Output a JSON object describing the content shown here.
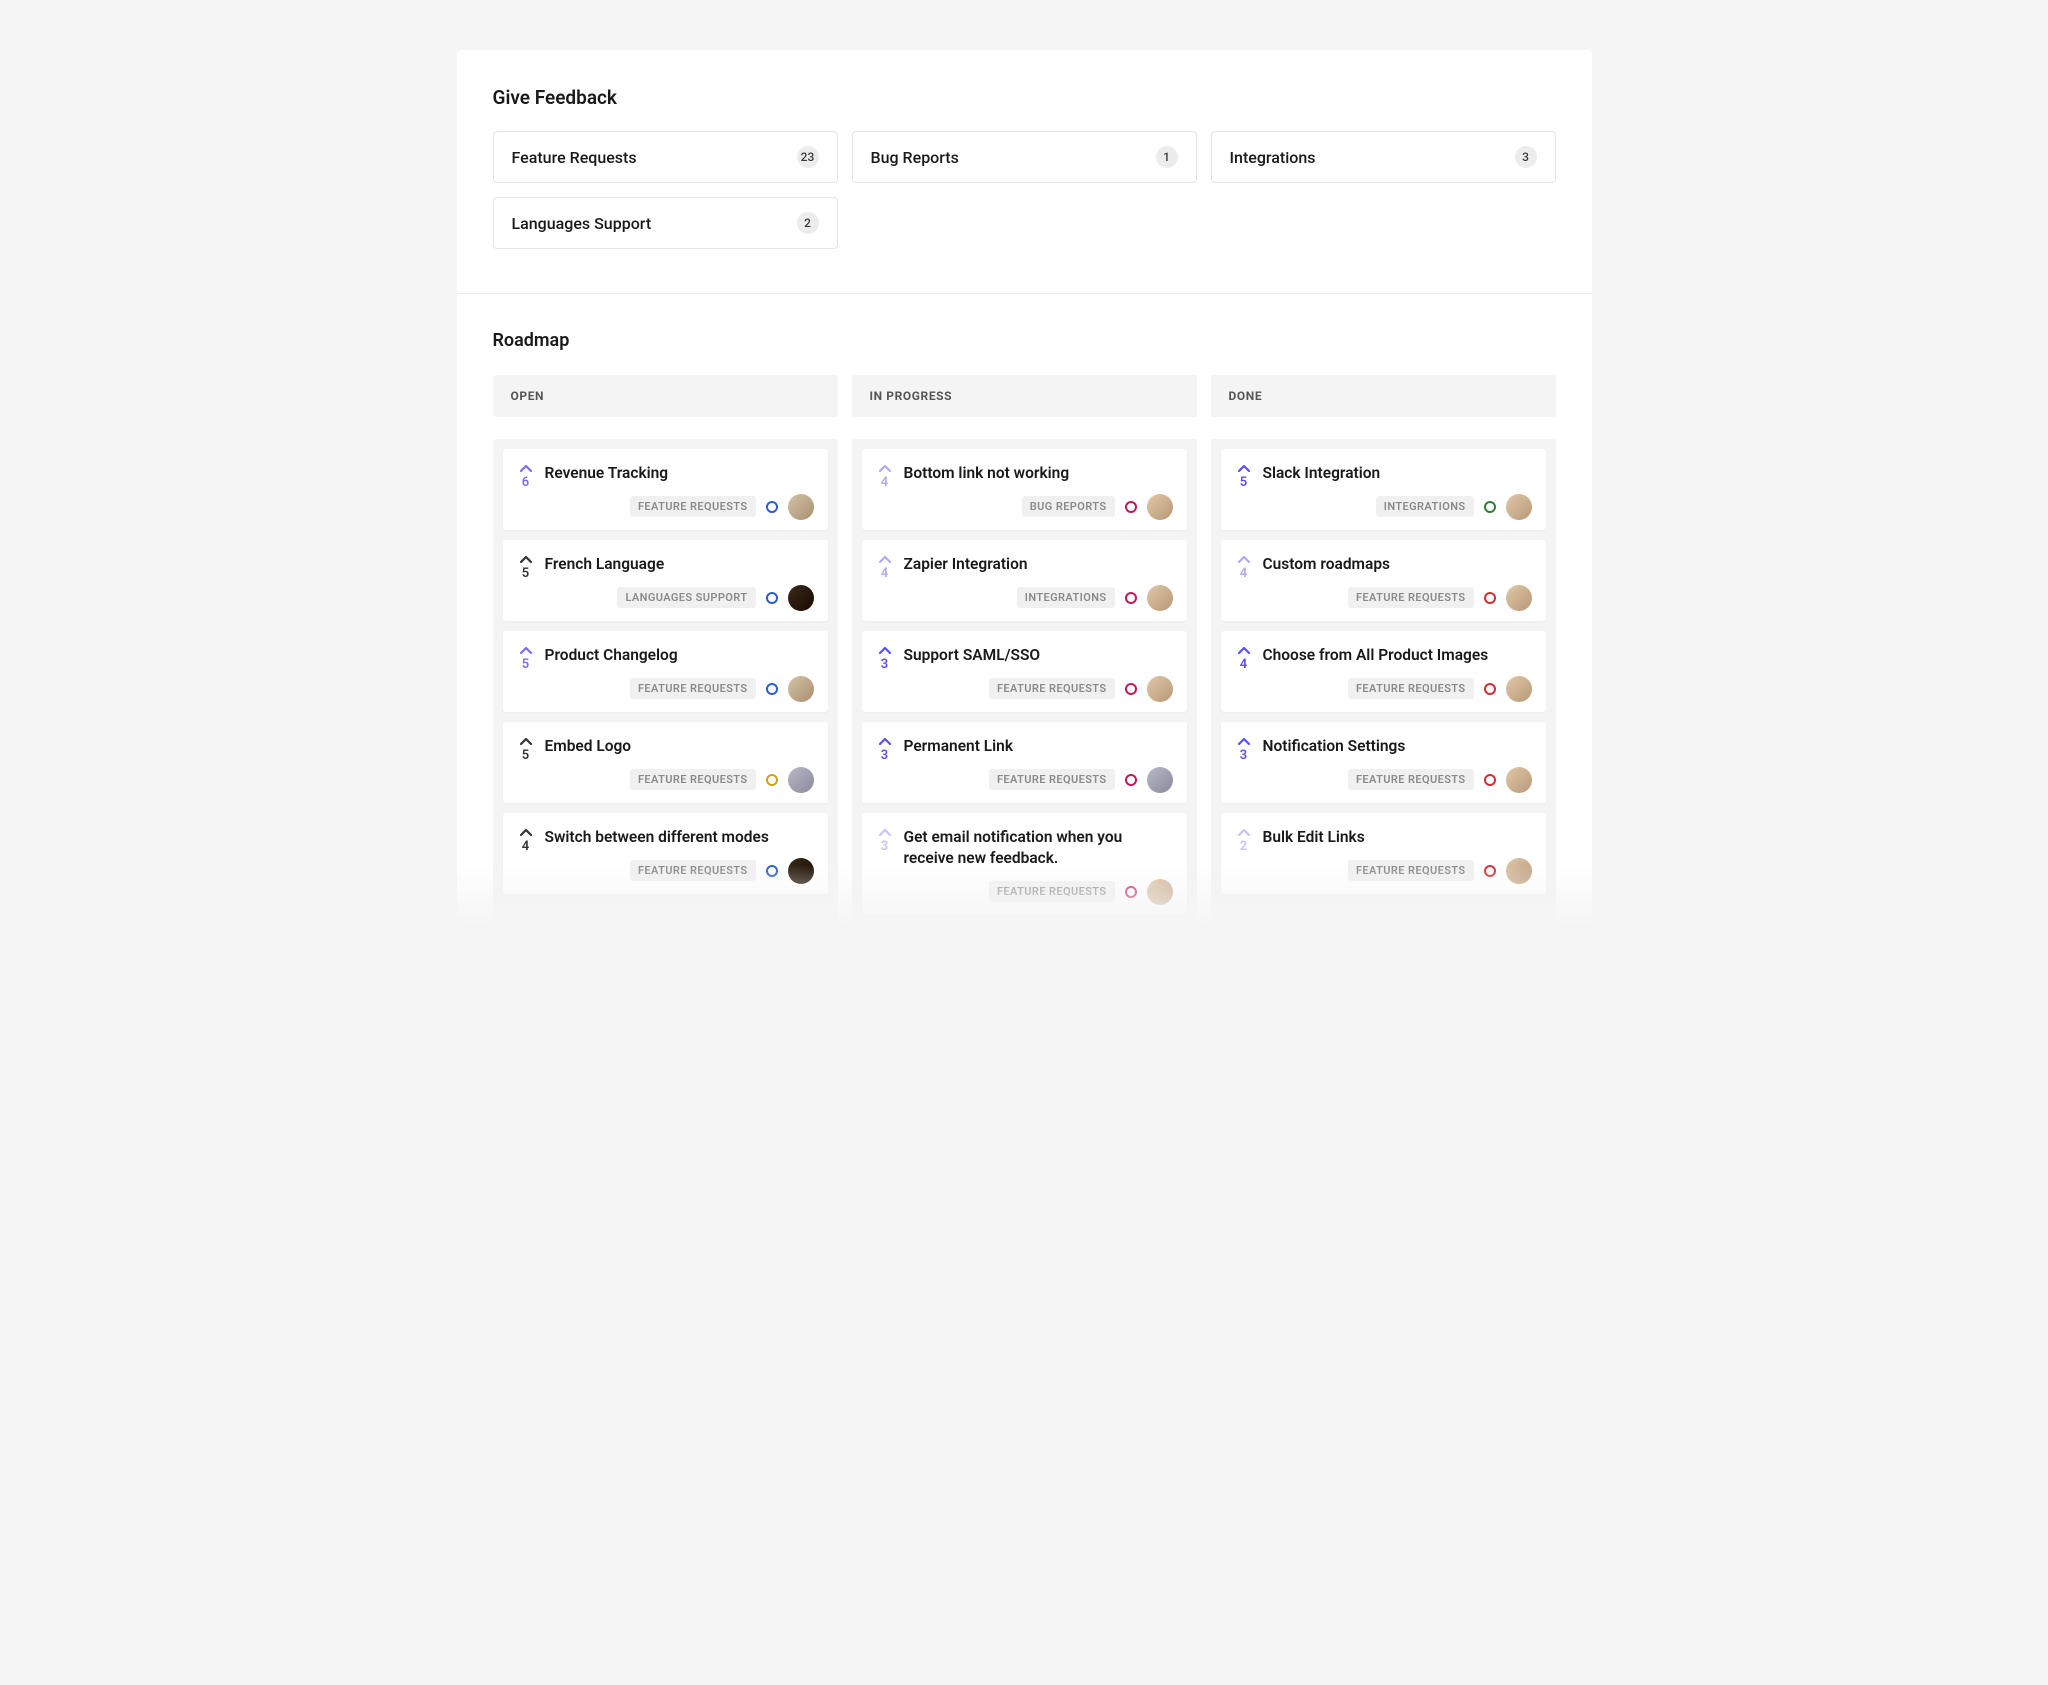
{
  "feedback": {
    "title": "Give Feedback",
    "categories": [
      {
        "label": "Feature Requests",
        "count": 23
      },
      {
        "label": "Bug Reports",
        "count": 1
      },
      {
        "label": "Integrations",
        "count": 3
      },
      {
        "label": "Languages Support",
        "count": 2
      }
    ]
  },
  "roadmap": {
    "title": "Roadmap",
    "columns": [
      {
        "header": "OPEN",
        "cards": [
          {
            "title": "Revenue Tracking",
            "votes": 6,
            "tag": "FEATURE REQUESTS",
            "dot": "#2a5bd7",
            "chev": "#7a6cff",
            "voted": true,
            "avatar": "a2"
          },
          {
            "title": "French Language",
            "votes": 5,
            "tag": "LANGUAGES SUPPORT",
            "dot": "#2a5bd7",
            "chev": "#333",
            "voted": false,
            "avatar": "a3"
          },
          {
            "title": "Product Changelog",
            "votes": 5,
            "tag": "FEATURE REQUESTS",
            "dot": "#2a5bd7",
            "chev": "#7a6cff",
            "voted": true,
            "avatar": "a2"
          },
          {
            "title": "Embed Logo",
            "votes": 5,
            "tag": "FEATURE REQUESTS",
            "dot": "#d4a017",
            "chev": "#333",
            "voted": false,
            "avatar": "a4"
          },
          {
            "title": "Switch between different modes",
            "votes": 4,
            "tag": "FEATURE REQUESTS",
            "dot": "#2a5bd7",
            "chev": "#333",
            "voted": false,
            "avatar": "a3"
          }
        ]
      },
      {
        "header": "IN PROGRESS",
        "cards": [
          {
            "title": "Bottom link not working",
            "votes": 4,
            "tag": "BUG REPORTS",
            "dot": "#c2185b",
            "chev": "#b0a8ff",
            "voted": true,
            "avatar": "a5"
          },
          {
            "title": "Zapier Integration",
            "votes": 4,
            "tag": "INTEGRATIONS",
            "dot": "#c2185b",
            "chev": "#b0a8ff",
            "voted": true,
            "avatar": "a5"
          },
          {
            "title": "Support SAML/SSO",
            "votes": 3,
            "tag": "FEATURE REQUESTS",
            "dot": "#c2185b",
            "chev": "#5a4fff",
            "voted": true,
            "avatar": "a5"
          },
          {
            "title": "Permanent Link",
            "votes": 3,
            "tag": "FEATURE REQUESTS",
            "dot": "#c2185b",
            "chev": "#5a4fff",
            "voted": true,
            "avatar": "a4"
          },
          {
            "title": "Get email notification when you receive new feedback.",
            "votes": 3,
            "tag": "FEATURE REQUESTS",
            "dot": "#c2185b",
            "chev": "#c8c2ff",
            "voted": true,
            "avatar": "a5"
          }
        ]
      },
      {
        "header": "DONE",
        "cards": [
          {
            "title": "Slack Integration",
            "votes": 5,
            "tag": "INTEGRATIONS",
            "dot": "#2e7d32",
            "chev": "#5a4fff",
            "voted": true,
            "avatar": "a5"
          },
          {
            "title": "Custom roadmaps",
            "votes": 4,
            "tag": "FEATURE REQUESTS",
            "dot": "#d32f2f",
            "chev": "#b0a8ff",
            "voted": true,
            "avatar": "a5"
          },
          {
            "title": "Choose from All Product Images",
            "votes": 4,
            "tag": "FEATURE REQUESTS",
            "dot": "#d32f2f",
            "chev": "#5a4fff",
            "voted": true,
            "avatar": "a5"
          },
          {
            "title": "Notification Settings",
            "votes": 3,
            "tag": "FEATURE REQUESTS",
            "dot": "#d32f2f",
            "chev": "#5a4fff",
            "voted": true,
            "avatar": "a5"
          },
          {
            "title": "Bulk Edit Links",
            "votes": 2,
            "tag": "FEATURE REQUESTS",
            "dot": "#d32f2f",
            "chev": "#c8c2ff",
            "voted": true,
            "avatar": "a5"
          }
        ]
      }
    ]
  }
}
